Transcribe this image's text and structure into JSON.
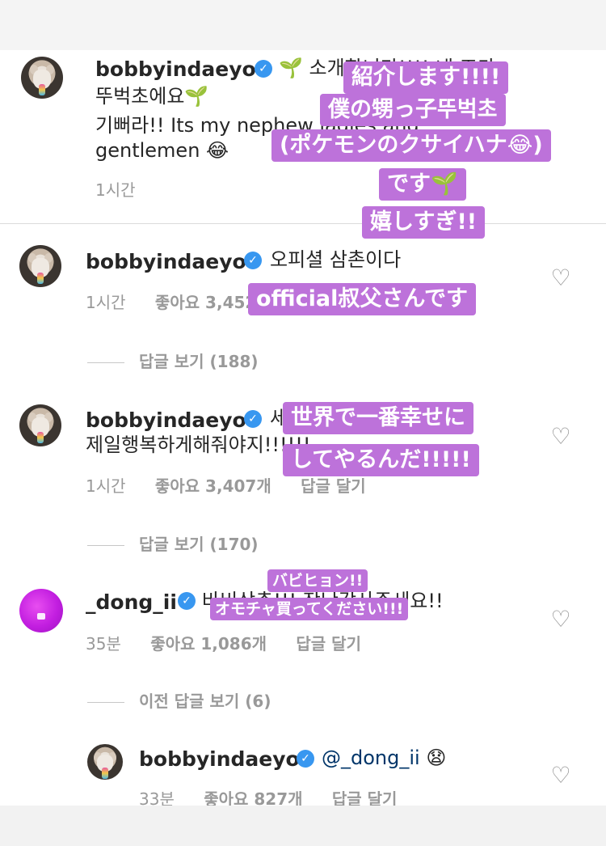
{
  "comments": [
    {
      "username": "bobbyindaeyo",
      "text_line1": "🌱 소개합니다!!!! 내 조카",
      "text_line2": "뚜벅초에요🌱",
      "text_line3": "기뻐라!! Its my nephew ladies and",
      "text_line4": "gentlemen 😂",
      "time": "1시간"
    },
    {
      "username": "bobbyindaeyo",
      "text": "오피셜 삼촌이다",
      "time": "1시간",
      "likes": "좋아요 3,452개",
      "replies": "답글 보기 (188)"
    },
    {
      "username": "bobbyindaeyo",
      "text_line1": "세상에서",
      "text_line2": "제일행복하게해줘야지!!!!!!",
      "time": "1시간",
      "likes": "좋아요 3,407개",
      "reply": "답글 달기",
      "replies": "답글 보기 (170)"
    },
    {
      "username": "_dong_ii",
      "text": "바비삼촌!!! 장난감사주세요!!",
      "time": "35분",
      "likes": "좋아요 1,086개",
      "reply": "답글 달기",
      "replies": "이전 답글 보기 (6)"
    },
    {
      "username": "bobbyindaeyo",
      "mention": "@_dong_ii",
      "emoji": "😧",
      "time": "33분",
      "likes": "좋아요 827개",
      "reply": "답글 달기"
    }
  ],
  "stickers": {
    "s1_line1": "紹介します!!!!",
    "s1_line2": "僕の甥っ子뚜벅초",
    "s1_line3": "(ポケモンのクサイハナ😂)",
    "s1_line4": "です🌱",
    "s1_line5": "嬉しすぎ!!",
    "s2": "official叔父さんです",
    "s3_line1": "世界で一番幸せに",
    "s3_line2": "してやるんだ!!!!!",
    "s4_line1": "バビヒョン!!",
    "s4_line2": "オモチャ買ってください!!!"
  },
  "icons": {
    "verified": "verified-badge-icon",
    "heart": "heart-outline-icon",
    "sprout": "seedling-emoji"
  },
  "colors": {
    "sticker": "#bd72da",
    "verified": "#3897f0",
    "meta": "#999999"
  }
}
